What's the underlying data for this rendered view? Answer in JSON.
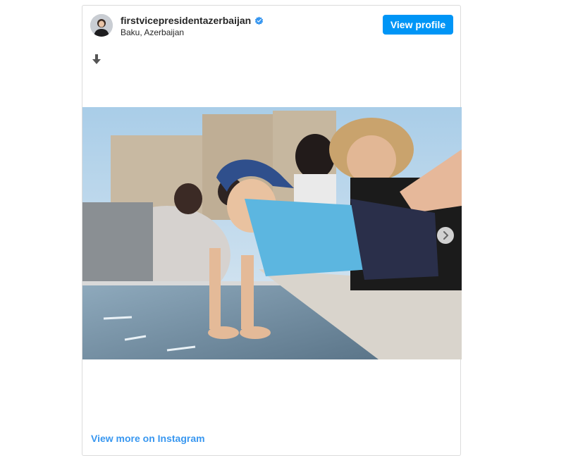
{
  "post": {
    "username": "firstvicepresidentazerbaijan",
    "location": "Baku, Azerbaijan",
    "view_profile_label": "View profile",
    "view_more_label": "View more on Instagram",
    "verified": true
  },
  "icons": {
    "verified": "verified-badge-icon",
    "caption": "arrow-down-icon",
    "carousel": "chevron-right-icon"
  },
  "colors": {
    "accent": "#0095f6",
    "link": "#3897f0",
    "text": "#262626",
    "border": "#dbdbdb"
  }
}
